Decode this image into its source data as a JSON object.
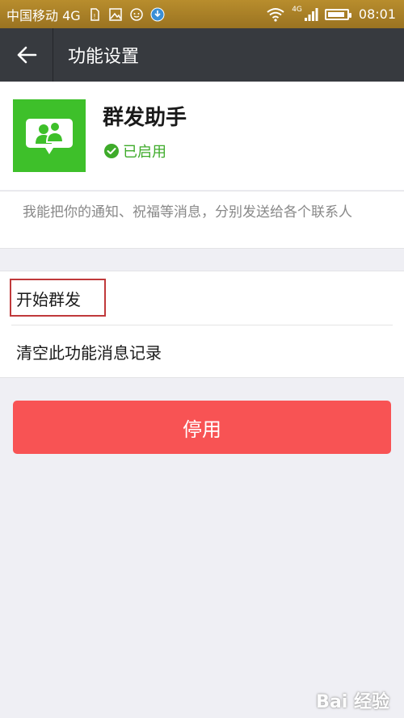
{
  "status_bar": {
    "carrier": "中国移动 4G",
    "network": "4G",
    "time": "08:01",
    "battery_level": 0.7
  },
  "nav": {
    "title": "功能设置",
    "back_icon": "back-arrow-icon"
  },
  "feature": {
    "name": "群发助手",
    "status": "已启用",
    "icon": "group-chat-icon",
    "icon_color": "#3ec02a",
    "status_color": "#3eab2a"
  },
  "description": "我能把你的通知、祝福等消息，分别发送给各个联系人",
  "menu": {
    "items": [
      {
        "label": "开始群发"
      },
      {
        "label": "清空此功能消息记录"
      }
    ]
  },
  "disable_button": {
    "label": "停用",
    "color": "#f85354"
  },
  "watermark": "Bai 经验"
}
